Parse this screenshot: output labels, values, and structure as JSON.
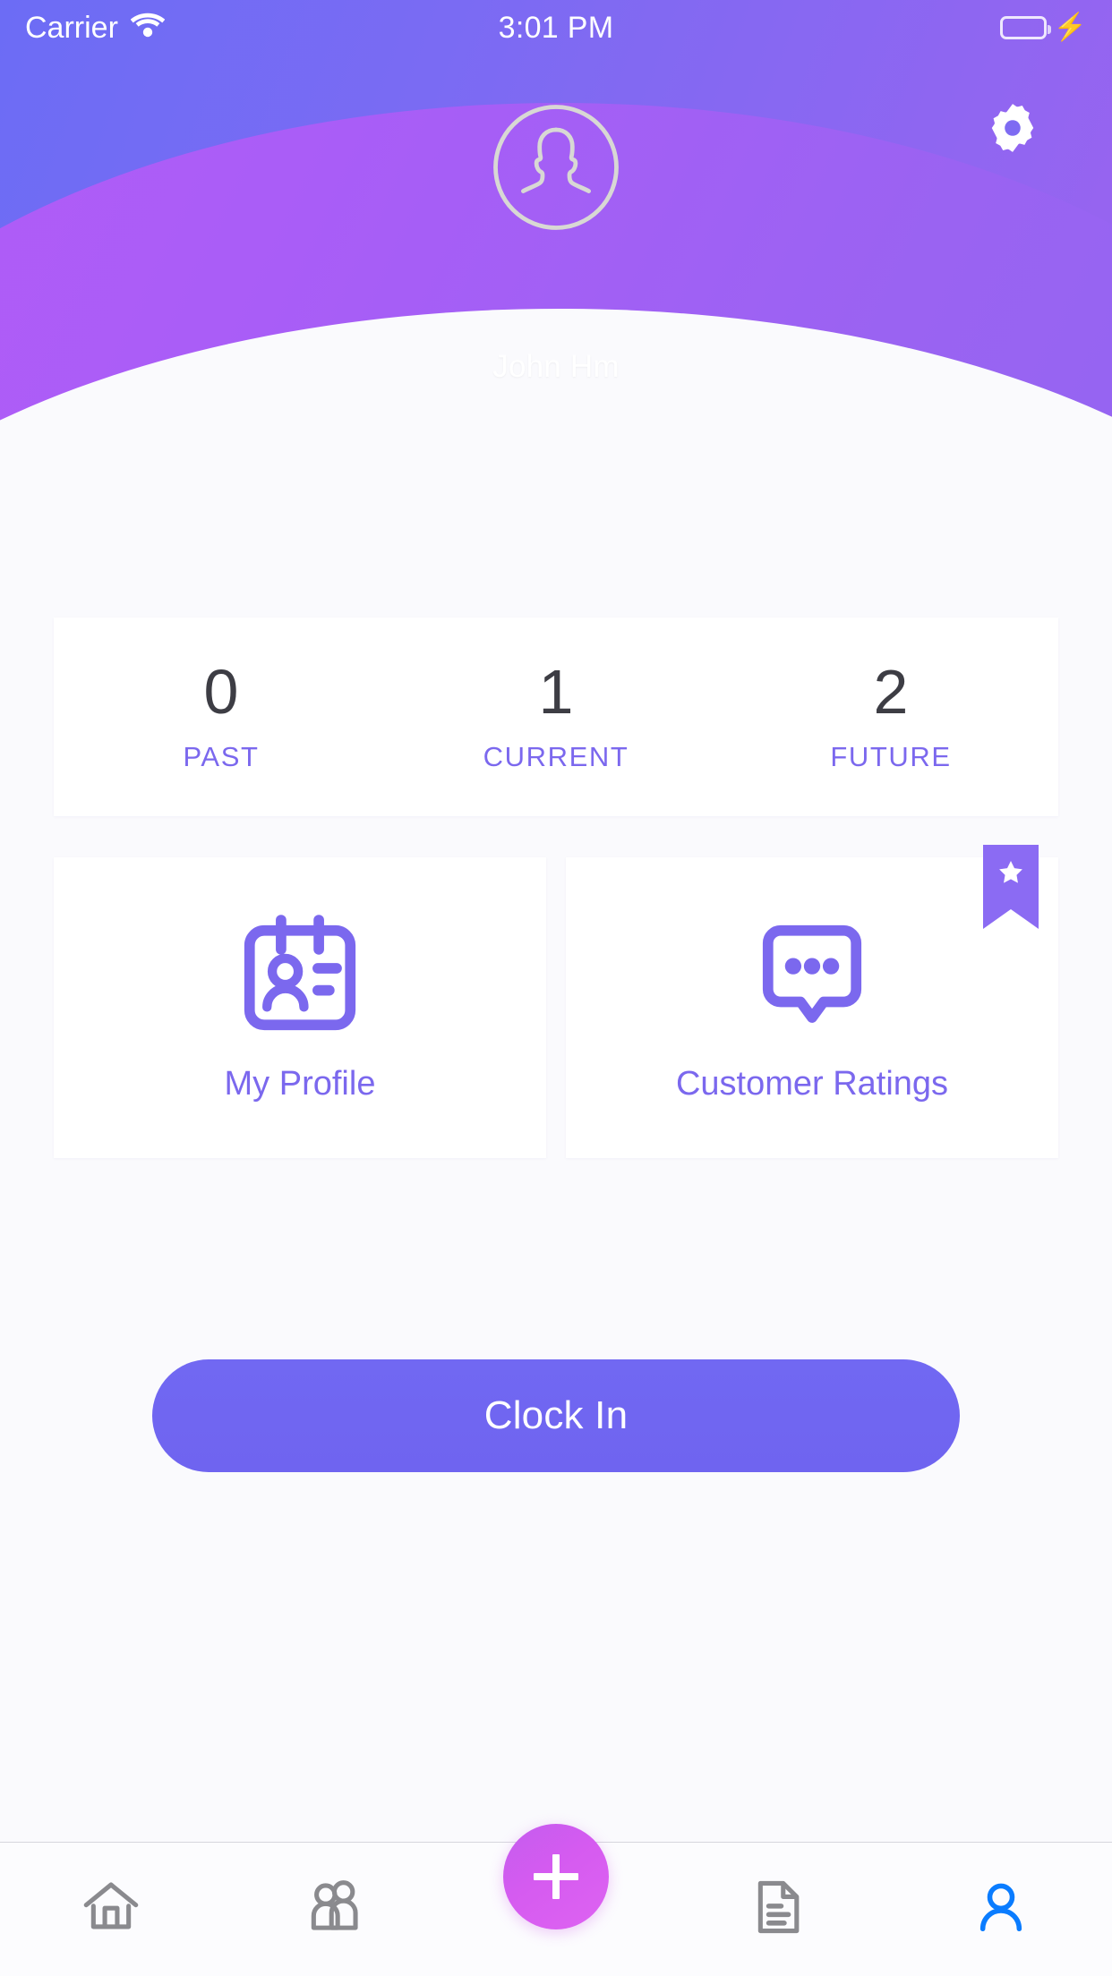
{
  "status_bar": {
    "carrier": "Carrier",
    "time": "3:01 PM",
    "wifi_icon": "wifi-icon",
    "battery_icon": "battery-icon",
    "charging_icon": "lightning-bolt-icon"
  },
  "header": {
    "user_name": "John Hm",
    "avatar_icon": "user-avatar-icon",
    "settings_icon": "gear-icon",
    "gradient_start": "#6C6CF5",
    "gradient_end": "#9B63F0",
    "wave_color": "#B45CF7"
  },
  "stats": {
    "items": [
      {
        "value": "0",
        "label": "PAST"
      },
      {
        "value": "1",
        "label": "CURRENT"
      },
      {
        "value": "2",
        "label": "FUTURE"
      }
    ],
    "value_color": "#3D3D44",
    "label_color": "#7B68EE"
  },
  "features": [
    {
      "label": "My Profile",
      "icon": "id-badge-icon",
      "badge": null
    },
    {
      "label": "Customer Ratings",
      "icon": "chat-bubble-icon",
      "badge": "star-ribbon-icon"
    }
  ],
  "primary_action": {
    "label": "Clock In",
    "color": "#7168F2"
  },
  "tabbar": {
    "items": [
      {
        "name": "home",
        "icon": "home-icon",
        "active": false
      },
      {
        "name": "people",
        "icon": "people-icon",
        "active": false
      },
      {
        "name": "add",
        "icon": "plus-icon",
        "active": false
      },
      {
        "name": "documents",
        "icon": "document-icon",
        "active": false
      },
      {
        "name": "profile",
        "icon": "person-icon",
        "active": true
      }
    ],
    "inactive_color": "#8A8A8E",
    "active_color": "#0A7CFF",
    "fab_color": "#D55BF0"
  }
}
